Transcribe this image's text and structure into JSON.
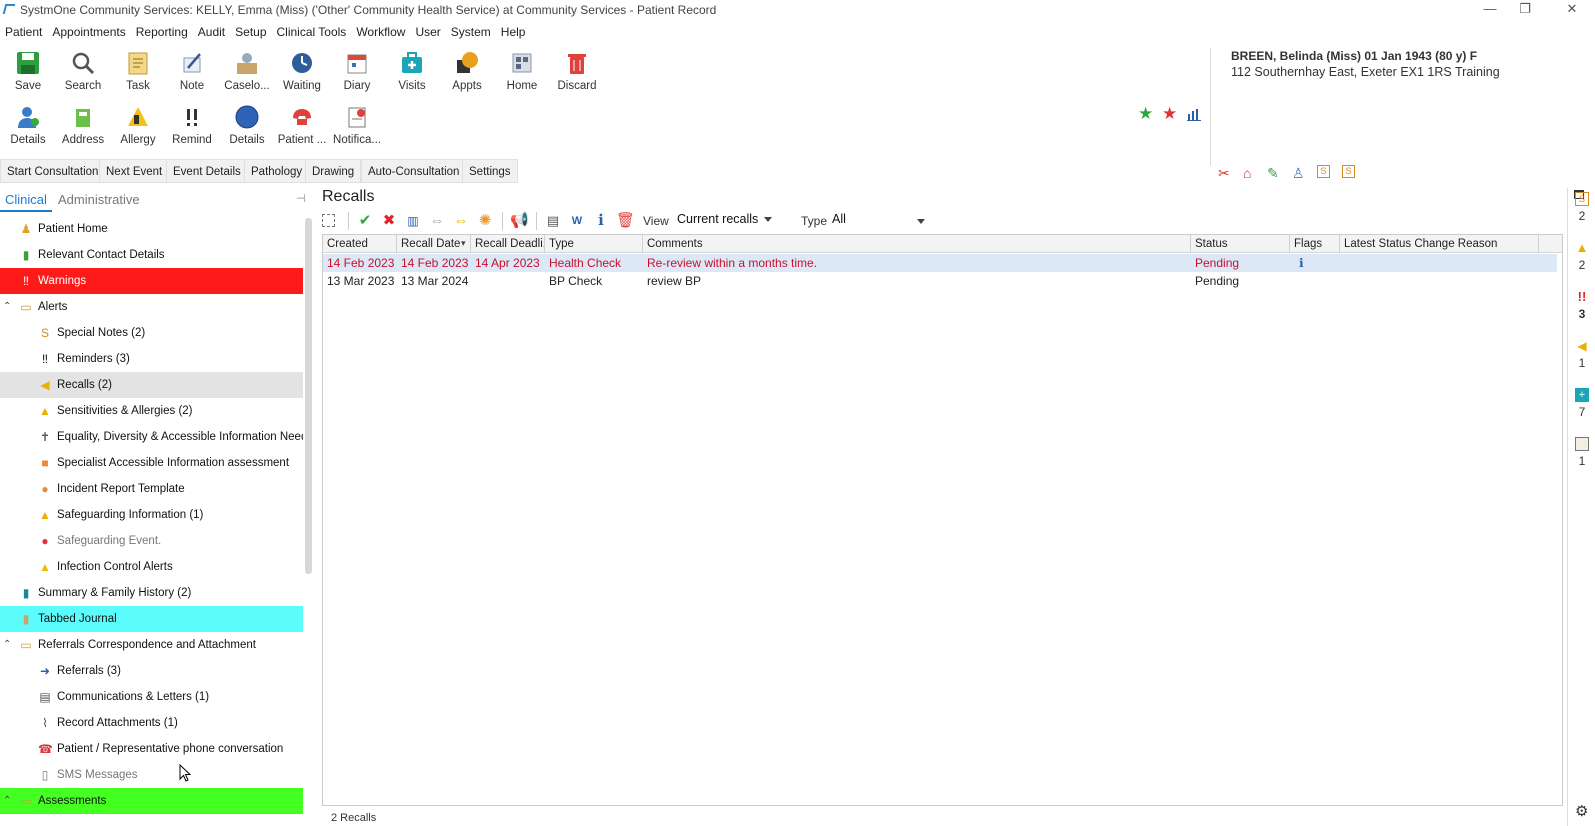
{
  "window": {
    "title": "SystmOne Community Services: KELLY, Emma (Miss) ('Other' Community Health Service) at Community Services - Patient Record",
    "minimize": "—",
    "restore": "❐",
    "close": "✕"
  },
  "menu": [
    "Patient",
    "Appointments",
    "Reporting",
    "Audit",
    "Setup",
    "Clinical Tools",
    "Workflow",
    "User",
    "System",
    "Help"
  ],
  "toolbar_row1": [
    {
      "label": "Save",
      "icon": "save-icon"
    },
    {
      "label": "Search",
      "icon": "search-icon"
    },
    {
      "label": "Task",
      "icon": "task-icon"
    },
    {
      "label": "Note",
      "icon": "note-icon"
    },
    {
      "label": "Caselo...",
      "icon": "caseload-icon"
    },
    {
      "label": "Waiting",
      "icon": "waiting-icon"
    },
    {
      "label": "Diary",
      "icon": "diary-icon"
    },
    {
      "label": "Visits",
      "icon": "visits-icon"
    },
    {
      "label": "Appts",
      "icon": "appointments-icon"
    },
    {
      "label": "Home",
      "icon": "home-icon"
    },
    {
      "label": "Discard",
      "icon": "discard-icon"
    }
  ],
  "toolbar_row2": [
    {
      "label": "Details",
      "icon": "details-icon"
    },
    {
      "label": "Address",
      "icon": "address-icon"
    },
    {
      "label": "Allergy",
      "icon": "allergy-icon"
    },
    {
      "label": "Remind",
      "icon": "remind-icon"
    },
    {
      "label": "Details",
      "icon": "details-circle-icon"
    },
    {
      "label": "Patient ...",
      "icon": "patient-phone-icon"
    },
    {
      "label": "Notifica...",
      "icon": "notification-icon"
    }
  ],
  "patient": {
    "name_line": "BREEN, Belinda (Miss) 01 Jan 1943 (80 y) F",
    "address_line": "112 Southernhay East, Exeter EX1 1RS  Training"
  },
  "consultation_buttons": [
    "Start Consultation",
    "Next Event",
    "Event Details",
    "Pathology",
    "Drawing",
    "Auto-Consultation",
    "Settings"
  ],
  "left_tabs": {
    "clinical": "Clinical",
    "administrative": "Administrative"
  },
  "tree": [
    {
      "label": "Patient Home",
      "icon": "person-icon",
      "level": 0
    },
    {
      "label": "Relevant Contact Details",
      "icon": "phone-icon",
      "level": 0
    },
    {
      "label": "Warnings",
      "icon": "warning-icon",
      "level": 0,
      "highlight": "#ff1a1a"
    },
    {
      "label": "Alerts",
      "icon": "folder-icon",
      "level": 0,
      "expanded": true
    },
    {
      "label": "Special Notes (2)",
      "icon": "special-notes-icon",
      "level": 1
    },
    {
      "label": "Reminders (3)",
      "icon": "reminder-icon",
      "level": 1
    },
    {
      "label": "Recalls (2)",
      "icon": "recall-icon",
      "level": 1,
      "selected": true
    },
    {
      "label": "Sensitivities & Allergies (2)",
      "icon": "allergy-icon",
      "level": 1
    },
    {
      "label": "Equality, Diversity & Accessible Information Need.",
      "icon": "accessibility-icon",
      "level": 1
    },
    {
      "label": "Specialist Accessible Information assessment",
      "icon": "square-icon",
      "level": 1
    },
    {
      "label": "Incident Report Template",
      "icon": "circle-icon",
      "level": 1
    },
    {
      "label": "Safeguarding Information (1)",
      "icon": "safeguarding-icon",
      "level": 1
    },
    {
      "label": "Safeguarding Event.",
      "icon": "alert-circle-icon",
      "level": 1,
      "muted": true
    },
    {
      "label": "Infection Control Alerts",
      "icon": "warning-triangle-icon",
      "level": 1
    },
    {
      "label": "Summary & Family History (2)",
      "icon": "book-icon",
      "level": 0
    },
    {
      "label": "Tabbed Journal",
      "icon": "journal-icon",
      "level": 0,
      "highlight": "#5cfcfc"
    },
    {
      "label": "Referrals Correspondence and Attachment",
      "icon": "folder-icon",
      "level": 0,
      "expanded": true
    },
    {
      "label": "Referrals (3)",
      "icon": "arrow-right-icon",
      "level": 1
    },
    {
      "label": "Communications & Letters (1)",
      "icon": "letter-icon",
      "level": 1
    },
    {
      "label": "Record Attachments (1)",
      "icon": "paperclip-icon",
      "level": 1
    },
    {
      "label": "Patient / Representative phone conversation",
      "icon": "phone-red-icon",
      "level": 1
    },
    {
      "label": "SMS Messages",
      "icon": "sms-icon",
      "level": 1,
      "muted": true
    },
    {
      "label": "Assessments",
      "icon": "folder-icon",
      "level": 0,
      "expanded": true,
      "highlight": "#44ff22"
    }
  ],
  "recalls": {
    "title": "Recalls",
    "view_label": "View",
    "view_value": "Current recalls",
    "type_label": "Type",
    "type_value": "All",
    "columns": [
      "Created",
      "Recall Date",
      "Recall Deadli...",
      "Type",
      "Comments",
      "Status",
      "Flags",
      "Latest Status Change Reason"
    ],
    "rows": [
      {
        "created": "14 Feb 2023",
        "recall_date": "14 Feb 2023",
        "deadline": "14 Apr 2023",
        "type": "Health Check",
        "comments": "Re-review within a months time.",
        "status": "Pending",
        "flags": "ℹ",
        "reason": ""
      },
      {
        "created": "13 Mar 2023",
        "recall_date": "13 Mar 2024",
        "deadline": "",
        "type": "BP Check",
        "comments": "review BP",
        "status": "Pending",
        "flags": "",
        "reason": ""
      }
    ],
    "count_text": "2 Recalls"
  },
  "right_strip": [
    {
      "icon": "special-notes-icon",
      "count": "2"
    },
    {
      "icon": "allergy-icon",
      "count": "2"
    },
    {
      "icon": "reminder-icon",
      "count": "3"
    },
    {
      "icon": "recall-icon",
      "count": "1"
    },
    {
      "icon": "visits-icon",
      "count": "7"
    },
    {
      "icon": "clipboard-icon",
      "count": "1"
    }
  ],
  "colors": {
    "warning_red": "#ff1a1a",
    "journal_cyan": "#5cfcfc",
    "assessments_green": "#44ff22",
    "recall_red": "#c8102e",
    "accent_blue": "#1a7bd6"
  }
}
